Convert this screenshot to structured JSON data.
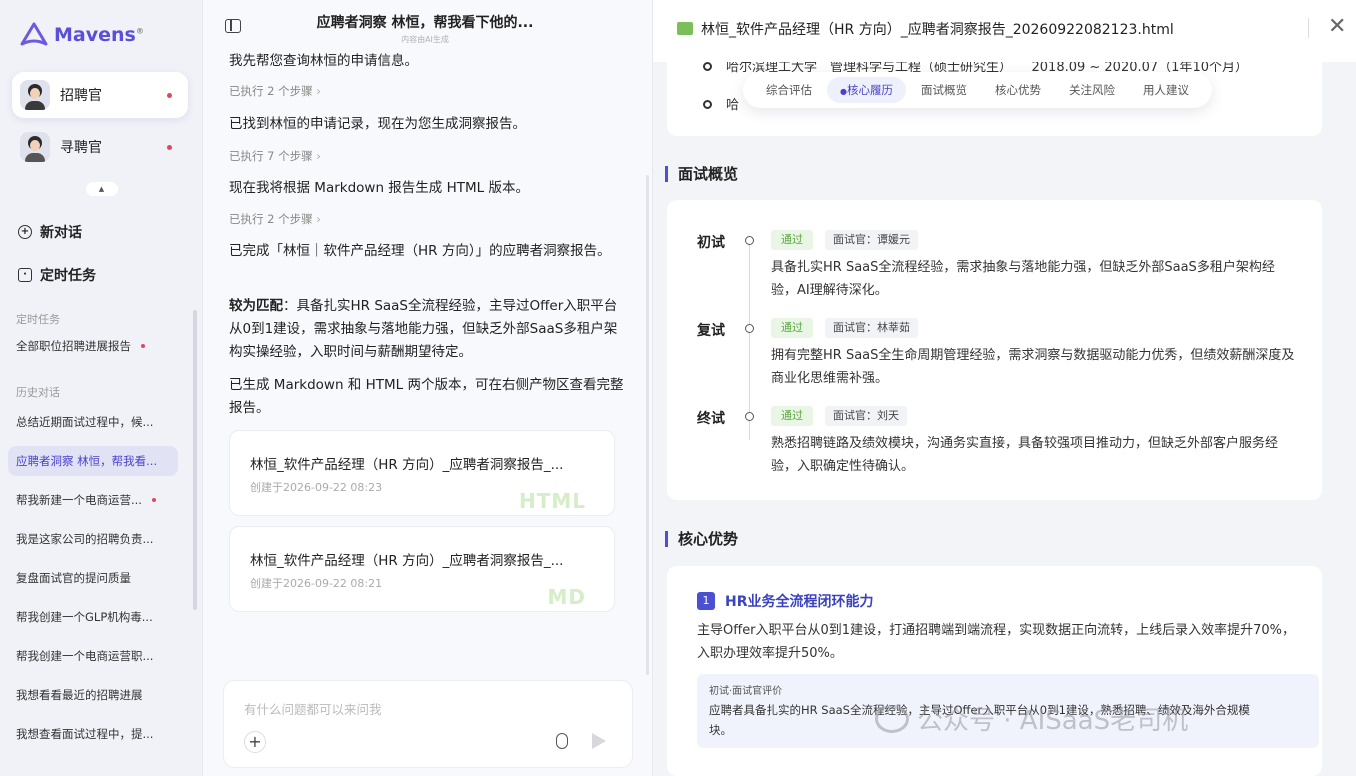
{
  "sidebar": {
    "brand": "Mavens",
    "brand_mark": "®",
    "agents": [
      {
        "label": "招聘官"
      },
      {
        "label": "寻聘官"
      }
    ],
    "collapse_glyph": "▲",
    "new_chat": "新对话",
    "scheduled_tasks": "定时任务",
    "section_scheduled": "定时任务",
    "scheduled_items": [
      {
        "label": "全部职位招聘进展报告"
      }
    ],
    "section_history": "历史对话",
    "history": [
      {
        "label": "总结近期面试过程中，候..."
      },
      {
        "label": "应聘者洞察 林恒，帮我看..."
      },
      {
        "label": "帮我新建一个电商运营..."
      },
      {
        "label": "我是这家公司的招聘负责..."
      },
      {
        "label": "复盘面试官的提问质量"
      },
      {
        "label": "帮我创建一个GLP机构毒..."
      },
      {
        "label": "帮我创建一个电商运营职..."
      },
      {
        "label": "我想看看最近的招聘进展"
      },
      {
        "label": "我想查看面试过程中，提..."
      }
    ]
  },
  "chat": {
    "title": "应聘者洞察 林恒，帮我看下他的...",
    "subtitle": "内容由AI生成",
    "messages": {
      "m0": "我先帮您查询林恒的申请信息。",
      "s1": "已执行 2 个步骤",
      "m1": "已找到林恒的申请记录，现在为您生成洞察报告。",
      "s2": "已执行 7 个步骤",
      "m2": "现在我将根据 Markdown 报告生成 HTML 版本。",
      "s3": "已执行 2 个步骤",
      "m3": "已完成「林恒｜软件产品经理（HR 方向）」的应聘者洞察报告。",
      "m4_label": "较为匹配",
      "m4": "：具备扎实HR SaaS全流程经验，主导过Offer入职平台从0到1建设，需求抽象与落地能力强，但缺乏外部SaaS多租户架构实操经验，入职时间与薪酬期望待定。",
      "m5": "已生成 Markdown 和 HTML 两个版本，可在右侧产物区查看完整报告。"
    },
    "cards": [
      {
        "title": "林恒_软件产品经理（HR 方向）_应聘者洞察报告_...",
        "date": "创建于2026-09-22 08:23",
        "badge": "HTML"
      },
      {
        "title": "林恒_软件产品经理（HR 方向）_应聘者洞察报告_...",
        "date": "创建于2026-09-22 08:21",
        "badge": "MD"
      }
    ],
    "input_placeholder": "有什么问题都可以来问我",
    "plus": "+"
  },
  "report": {
    "file_title": "林恒_软件产品经理（HR 方向）_应聘者洞察报告_20260922082123.html",
    "close": "✕",
    "edu": [
      {
        "text": "哈尔滨理工大学　管理科学与工程（硕士研究生）　　2018.09 ~ 2020.07（1年10个月）"
      },
      {
        "text": "哈"
      }
    ],
    "tabs": [
      "综合评估",
      "核心履历",
      "面试概览",
      "核心优势",
      "关注风险",
      "用人建议"
    ],
    "interview_heading": "面试概览",
    "pass_label": "通过",
    "stages": [
      {
        "name": "初试",
        "interviewer": "面试官：谭媛元",
        "desc": "具备扎实HR SaaS全流程经验，需求抽象与落地能力强，但缺乏外部SaaS多租户架构经验，AI理解待深化。"
      },
      {
        "name": "复试",
        "interviewer": "面试官：林莘茹",
        "desc": "拥有完整HR SaaS全生命周期管理经验，需求洞察与数据驱动能力优秀，但绩效薪酬深度及商业化思维需补强。"
      },
      {
        "name": "终试",
        "interviewer": "面试官：刘天",
        "desc": "熟悉招聘链路及绩效模块，沟通务实直接，具备较强项目推动力，但缺乏外部客户服务经验，入职确定性待确认。"
      }
    ],
    "advantages_heading": "核心优势",
    "advantage": {
      "num": "1",
      "title": "HR业务全流程闭环能力",
      "desc": "主导Offer入职平台从0到1建设，打通招聘端到端流程，实现数据正向流转，上线后录入效率提升70%，入职办理效率提升50%。",
      "eval_label": "初试·面试官评价",
      "eval_text": "应聘者具备扎实的HR SaaS全流程经验，主导过Offer入职平台从0到1建设，熟悉招聘、绩效及海外合规模块。"
    },
    "watermark": "公众号 · AISaaS老司机"
  }
}
